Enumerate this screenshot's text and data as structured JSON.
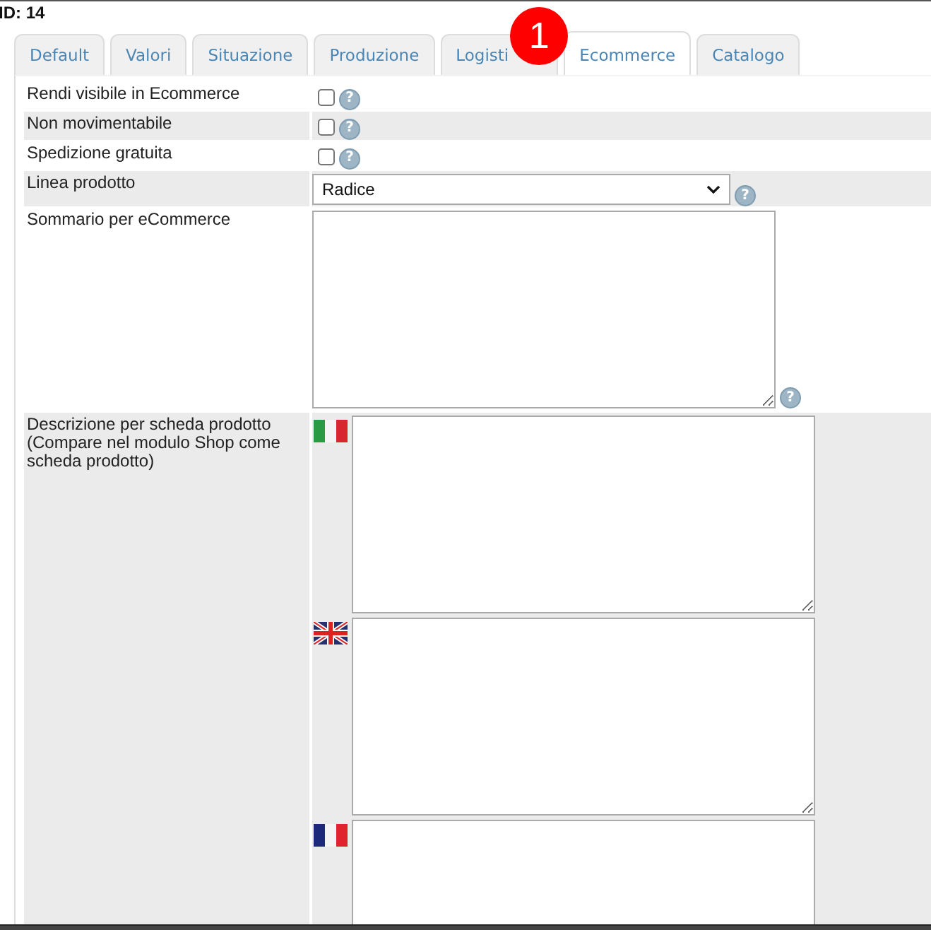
{
  "header": {
    "id_label": "ID: 14"
  },
  "tabs": [
    {
      "label": "Default",
      "selected": false
    },
    {
      "label": "Valori",
      "selected": false
    },
    {
      "label": "Situazione",
      "selected": false
    },
    {
      "label": "Produzione",
      "selected": false
    },
    {
      "label": "Logisti",
      "selected": false,
      "badge": "1"
    },
    {
      "label": "Ecommerce",
      "selected": true
    },
    {
      "label": "Catalogo",
      "selected": false
    }
  ],
  "fields": [
    {
      "kind": "checkbox",
      "label": "Rendi visibile in Ecommerce",
      "checked": false,
      "help": "?"
    },
    {
      "kind": "checkbox",
      "label": "Non movimentabile",
      "checked": false,
      "help": "?"
    },
    {
      "kind": "checkbox",
      "label": "Spedizione gratuita",
      "checked": false,
      "help": "?"
    },
    {
      "kind": "select",
      "label": "Linea prodotto",
      "value": "Radice",
      "help": "?"
    },
    {
      "kind": "textarea",
      "label": "Sommario per eCommerce",
      "help": "?"
    },
    {
      "kind": "multilang",
      "label": "Descrizione per scheda prodotto (Compare nel modulo Shop come scheda prodotto)",
      "languages": [
        {
          "kind": "it"
        },
        {
          "kind": "en"
        },
        {
          "kind": "fr"
        }
      ]
    }
  ]
}
